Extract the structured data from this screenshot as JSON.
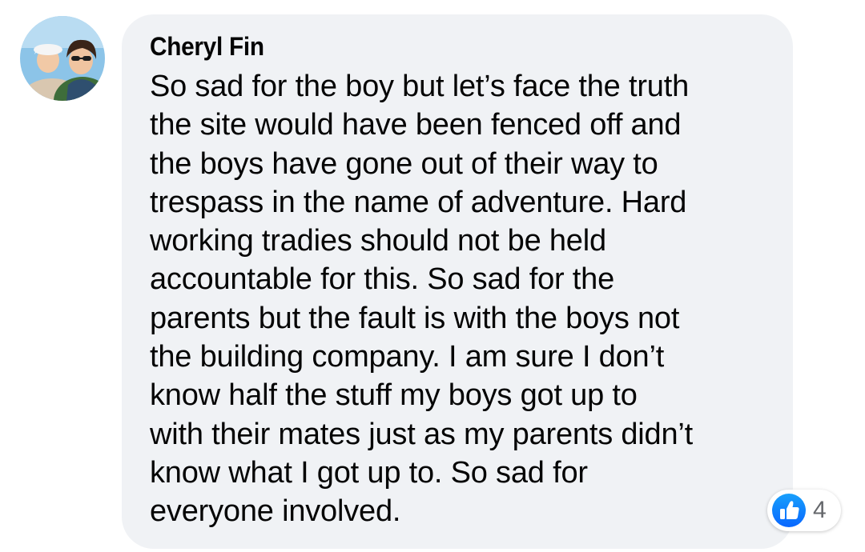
{
  "comment": {
    "author": "Cheryl Fin",
    "text": "So sad for the boy but let’s face the truth\nthe site would have been fenced off and\nthe boys have gone out of their way to\ntrespass in the name of adventure. Hard\nworking tradies should not be held\naccountable for this. So sad for the\nparents but the fault is with the boys not\nthe building company. I am sure I don’t\nknow half the stuff my boys got up to\nwith their mates just as my parents didn’t\nknow what I got up to. So sad for\neveryone involved."
  },
  "reactions": {
    "icon": "like-icon",
    "count": "4",
    "accent_color": "#1877f2"
  },
  "colors": {
    "bubble_background": "#f0f2f5",
    "text": "#050505",
    "secondary_text": "#65676b"
  }
}
